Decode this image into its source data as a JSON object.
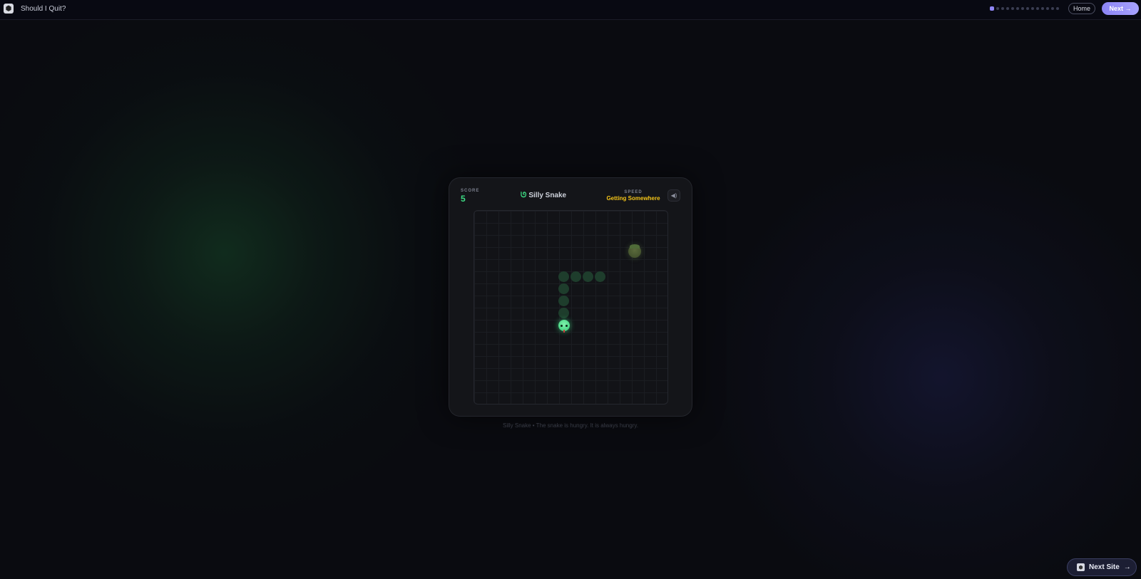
{
  "header": {
    "site_title": "Should I Quit?",
    "logo_icon": "dice-icon",
    "progress": {
      "total": 14,
      "current": 1
    },
    "home_label": "Home",
    "next_label": "Next →"
  },
  "game": {
    "score_label": "SCORE",
    "score": "5",
    "title": "Silly Snake",
    "title_icon": "snake-icon",
    "speed_label": "SPEED",
    "speed_value": "Getting Somewhere",
    "sound_icon": "speaker-icon",
    "colors": {
      "snake": "#3ddc84",
      "speed": "#f5c518",
      "accent": "#8f86f5"
    }
  },
  "footer": {
    "tagline": "Silly Snake • The snake is hungry. It is always hungry.",
    "next_site_label": "Next Site",
    "next_site_arrow": "→"
  }
}
